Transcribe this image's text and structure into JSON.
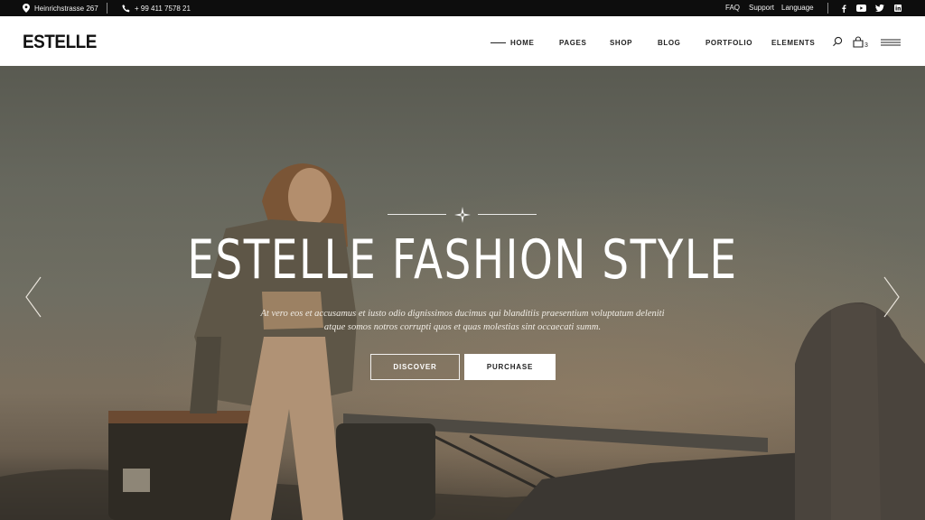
{
  "topbar": {
    "address": "Heinrichstrasse 267",
    "phone": "+ 99 411 7578 21",
    "links": [
      "FAQ",
      "Support",
      "Language"
    ],
    "icons": [
      "location-pin-icon",
      "phone-icon",
      "facebook-icon",
      "youtube-icon",
      "twitter-icon",
      "linkedin-icon"
    ]
  },
  "header": {
    "logo": "ESTELLE",
    "nav": [
      "HOME",
      "PAGES",
      "SHOP",
      "BLOG",
      "PORTFOLIO",
      "ELEMENTS"
    ],
    "cart_count": "3",
    "icons": [
      "search-icon",
      "cart-icon",
      "menu-icon"
    ]
  },
  "hero": {
    "title": "ESTELLE FASHION STYLE",
    "subtitle_line1": "At vero eos et accusamus et iusto odio dignissimos ducimus qui blanditiis praesentium voluptatum deleniti",
    "subtitle_line2": "atque somos notros corrupti quos et quas molestias sint occaecati summ.",
    "primary_button": "DISCOVER",
    "secondary_button": "PURCHASE",
    "icons": [
      "ornament-icon",
      "chevron-left-icon",
      "chevron-right-icon"
    ]
  },
  "colors": {
    "topbar_bg": "#0d0d0d",
    "header_bg": "#ffffff",
    "hero_text": "#ffffff"
  }
}
